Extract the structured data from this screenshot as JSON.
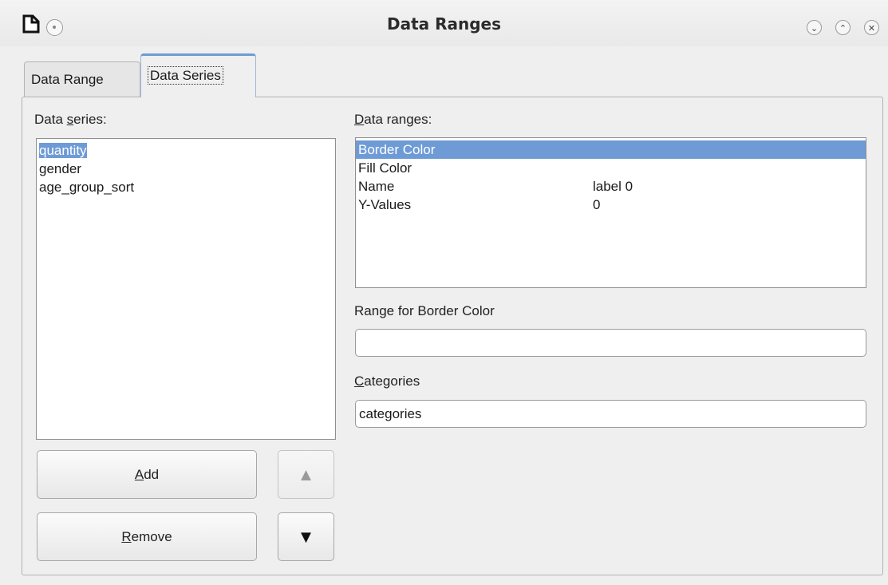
{
  "window": {
    "title": "Data Ranges",
    "controls": [
      "minimize",
      "maximize",
      "close"
    ]
  },
  "tabs": [
    {
      "label": "Data Range",
      "active": false
    },
    {
      "label": "Data Series",
      "active": true
    }
  ],
  "data_series": {
    "label_pre": "Data ",
    "label_mnemonic": "s",
    "label_post": "eries:",
    "items": [
      "quantity",
      "gender",
      "age_group_sort"
    ],
    "selected": "quantity"
  },
  "data_ranges": {
    "label_mnemonic": "D",
    "label_post": "ata ranges:",
    "rows": [
      {
        "role": "Border Color",
        "range": "",
        "selected": true
      },
      {
        "role": "Fill Color",
        "range": "",
        "selected": false
      },
      {
        "role": "Name",
        "range": "label 0",
        "selected": false
      },
      {
        "role": "Y-Values",
        "range": "0",
        "selected": false
      }
    ]
  },
  "range_for": {
    "label_pre": "Ran",
    "label_mnemonic": "g",
    "label_post": "e for Border Color",
    "value": ""
  },
  "categories": {
    "label_mnemonic": "C",
    "label_post": "ategories",
    "value": "categories"
  },
  "buttons": {
    "add_mnemonic": "A",
    "add_post": "dd",
    "remove_mnemonic": "R",
    "remove_post": "emove",
    "move_up": "▲",
    "move_down": "▼"
  },
  "colors": {
    "selection": "#6e9bd6",
    "window_bg": "#efefef",
    "accent_tab": "#6e9bd6"
  }
}
